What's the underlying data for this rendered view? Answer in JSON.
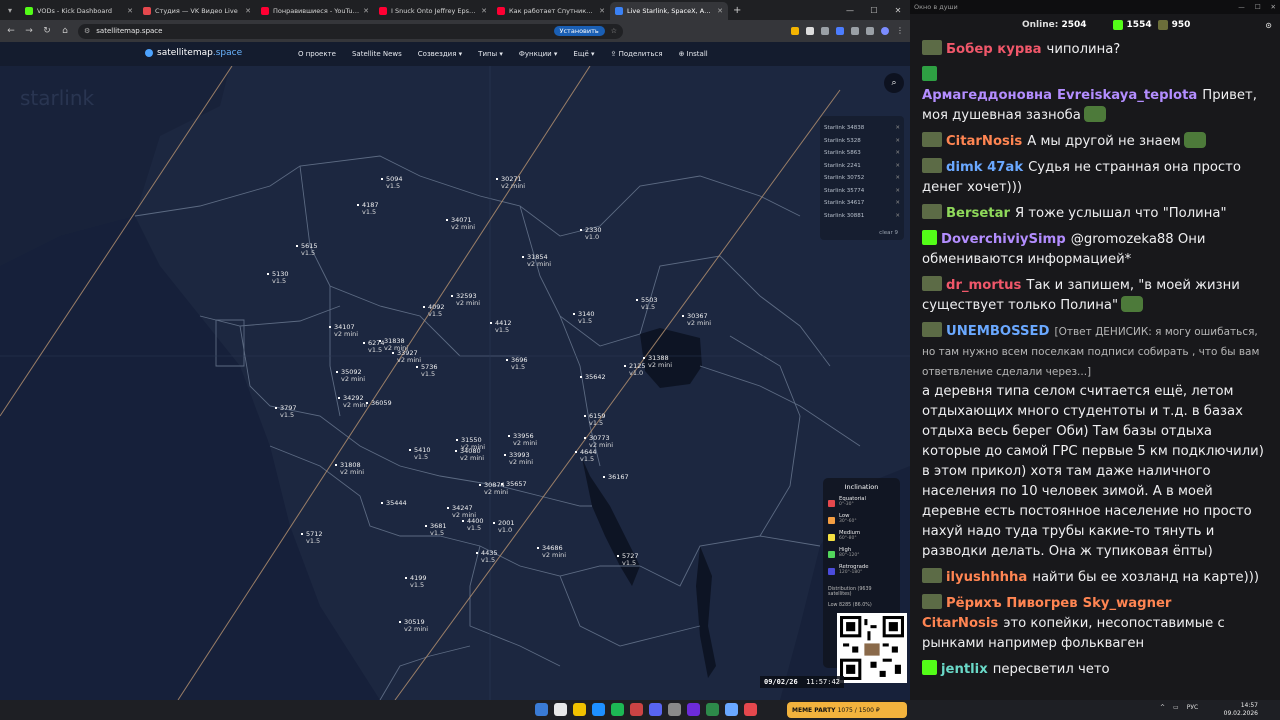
{
  "browser": {
    "tabs": [
      {
        "label": "VODs - Kick Dashboard",
        "color": "#53fc18",
        "active": false
      },
      {
        "label": "Студия — VK Видео Live",
        "color": "#e5484d",
        "active": false
      },
      {
        "label": "Понравившиеся - YouTube",
        "color": "#ff0033",
        "active": false
      },
      {
        "label": "I Snuck Onto Jeffrey Epstein's I",
        "color": "#ff0033",
        "active": false
      },
      {
        "label": "Как работает Спутниковый И",
        "color": "#ff0033",
        "active": false
      },
      {
        "label": "Live Starlink, SpaceX, Amazon",
        "color": "#3b82f6",
        "active": true
      }
    ],
    "url": "satellitemap.space",
    "install_label": "Установить"
  },
  "site": {
    "logo_main": "satellitemap",
    "logo_accent": ".space",
    "nav": [
      "О проекте",
      "Satellite News",
      "Созвездия ▾",
      "Типы ▾",
      "Функции ▾",
      "Ещё ▾",
      "⇪ Поделиться",
      "⊕ Install"
    ],
    "watermark": "starlink"
  },
  "satellites": [
    {
      "id": "5094",
      "ver": "v1.5"
    },
    {
      "id": "30271",
      "ver": "v2 mini"
    },
    {
      "id": "4187",
      "ver": "v1.5"
    },
    {
      "id": "34071",
      "ver": "v2 mini"
    },
    {
      "id": "2330",
      "ver": "v1.0"
    },
    {
      "id": "5615",
      "ver": "v1.5"
    },
    {
      "id": "31854",
      "ver": "v2 mini"
    },
    {
      "id": "5130",
      "ver": "v1.5"
    },
    {
      "id": "32593",
      "ver": "v2 mini"
    },
    {
      "id": "4092",
      "ver": "v1.5"
    },
    {
      "id": "5503",
      "ver": "v1.5"
    },
    {
      "id": "3140",
      "ver": "v1.5"
    },
    {
      "id": "30367",
      "ver": "v2 mini"
    },
    {
      "id": "34107",
      "ver": "v2 mini"
    },
    {
      "id": "4412",
      "ver": "v1.5"
    },
    {
      "id": "31838",
      "ver": "v2 mini"
    },
    {
      "id": "6274",
      "ver": "v1.5"
    },
    {
      "id": "33927",
      "ver": "v2 mini"
    },
    {
      "id": "3696",
      "ver": "v1.5"
    },
    {
      "id": "31388",
      "ver": "v2 mini"
    },
    {
      "id": "5736",
      "ver": "v1.5"
    },
    {
      "id": "2125",
      "ver": "v1.0"
    },
    {
      "id": "35092",
      "ver": "v2 mini"
    },
    {
      "id": "35642",
      "ver": ""
    },
    {
      "id": "34292",
      "ver": "v2 mini"
    },
    {
      "id": "36059",
      "ver": ""
    },
    {
      "id": "3797",
      "ver": "v1.5"
    },
    {
      "id": "6159",
      "ver": "v1.5"
    },
    {
      "id": "31550",
      "ver": "v2 mini"
    },
    {
      "id": "33956",
      "ver": "v2 mini"
    },
    {
      "id": "30773",
      "ver": "v2 mini"
    },
    {
      "id": "5410",
      "ver": "v1.5"
    },
    {
      "id": "34080",
      "ver": "v2 mini"
    },
    {
      "id": "33993",
      "ver": "v2 mini"
    },
    {
      "id": "4644",
      "ver": "v1.5"
    },
    {
      "id": "31808",
      "ver": "v2 mini"
    },
    {
      "id": "36167",
      "ver": ""
    },
    {
      "id": "30874",
      "ver": "v2 mini"
    },
    {
      "id": "35657",
      "ver": ""
    },
    {
      "id": "35444",
      "ver": ""
    },
    {
      "id": "34247",
      "ver": "v2 mini"
    },
    {
      "id": "3681",
      "ver": "v1.5"
    },
    {
      "id": "4400",
      "ver": "v1.5"
    },
    {
      "id": "2001",
      "ver": "v1.0"
    },
    {
      "id": "5712",
      "ver": "v1.5"
    },
    {
      "id": "34686",
      "ver": "v2 mini"
    },
    {
      "id": "4435",
      "ver": "v1.5"
    },
    {
      "id": "5727",
      "ver": "v1.5"
    },
    {
      "id": "4199",
      "ver": "v1.5"
    },
    {
      "id": "30519",
      "ver": "v2 mini"
    }
  ],
  "tracked": {
    "items": [
      "Starlink 34838",
      "Starlink 5328",
      "Starlink 5863",
      "Starlink 2241",
      "Starlink 30752",
      "Starlink 35774",
      "Starlink 34617",
      "Starlink 30881"
    ],
    "clear_label": "clear 9"
  },
  "inclination": {
    "title": "Inclination",
    "rows": [
      {
        "name": "Equatorial",
        "range": "0°-30°",
        "color": "#e5484d"
      },
      {
        "name": "Low",
        "range": "30°-60°",
        "color": "#f59e42"
      },
      {
        "name": "Medium",
        "range": "60°-80°",
        "color": "#f5e142"
      },
      {
        "name": "High",
        "range": "80°-120°",
        "color": "#52d65c"
      },
      {
        "name": "Retrograde",
        "range": "120°-180°",
        "color": "#4b4bdc"
      }
    ],
    "distribution": "Distribution (9639 satellites)",
    "low_label": "Low",
    "low_value": "8285 (86.0%)"
  },
  "timebar": {
    "date": "09/02/26",
    "time": "11:57:42"
  },
  "chat": {
    "window_title": "Окно в души",
    "online_label": "Online:",
    "online_count": "2504",
    "kick_count": "1554",
    "other_count": "950",
    "messages": [
      {
        "user": "Бобер курва",
        "color": "#f0576a",
        "text": "чиполина?",
        "badge": "sub"
      },
      {
        "user": "Армагеддоновна",
        "user2": "Evreiskaya_teplota",
        "color": "#b38dff",
        "text": "Привет, моя душевная зазноба",
        "badge": "shield",
        "emote": true
      },
      {
        "user": "CitarNosis",
        "color": "#ff8552",
        "text": "А мы другой не знаем",
        "badge": "sub",
        "emote": true
      },
      {
        "user": "dimk 47ak",
        "color": "#6aa8ff",
        "text": "Судья не странная она просто денег хочет)))",
        "badge": "sub"
      },
      {
        "user": "Bersetar",
        "color": "#8fd95a",
        "text": "Я тоже услышал что \"Полина\"",
        "badge": "sub"
      },
      {
        "user": "DoverchiviySimp",
        "color": "#b38dff",
        "text": "@gromozeka88 Они обмениваются информацией*",
        "badge": "k"
      },
      {
        "user": "dr_mortus",
        "color": "#f0576a",
        "text": "Так и запишем, \"в моей жизни существует только Полина\"",
        "badge": "sub",
        "emote": true
      },
      {
        "user": "UNEMBOSSED",
        "color": "#6aa8ff",
        "reply": "[Ответ ДЕНИСИК: я могу ошибаться, но там нужно всем поселкам подписи собирать , что бы вам ответвление сделали через...]",
        "text": "а деревня типа селом считается ещё, летом отдыхающих много студентоты и т.д. в базах отдыха весь берег Оби) Там базы отдыха которые до самой ГРС первые 5 км подключили) в этом прикол) хотя там даже наличного населения по 10 человек зимой. А в моей деревне есть постоянное население но просто нахуй надо туда трубы какие-то тянуть и разводки делать. Она ж тупиковая ёпты)",
        "badge": "sub"
      },
      {
        "user": "ilyushhhha",
        "color": "#ff8552",
        "text": "найти бы ее хозланд на карте)))",
        "badge": "sub"
      },
      {
        "user": "Рёрихъ Пивогрев",
        "user2": "Sky_wagner CitarNosis",
        "color": "#ff8552",
        "text": "это копейки, несопоставимые с рынками например фолькваген",
        "badge": "sub"
      },
      {
        "user": "jentlix",
        "color": "#6ad9c8",
        "text": "пересветил чето",
        "badge": "k"
      }
    ]
  },
  "taskbar": {
    "meme_label": "MEME PARTY",
    "meme_value": "1075 / 1500 ₽",
    "lang": "РУС",
    "time": "14:57",
    "date": "09.02.2026"
  }
}
